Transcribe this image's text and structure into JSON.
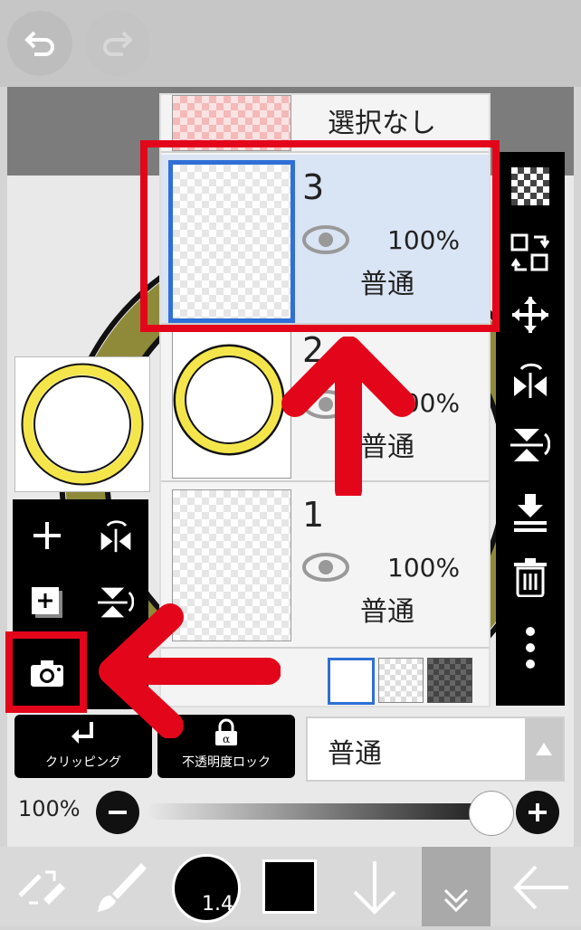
{
  "layers": [
    {
      "num": "3",
      "opacity": "100%",
      "mode": "普通",
      "selected": true
    },
    {
      "num": "2",
      "opacity": "100%",
      "mode": "普通",
      "selected": false
    },
    {
      "num": "1",
      "opacity": "100%",
      "mode": "普通",
      "selected": false
    }
  ],
  "selection_label": "選択なし",
  "clipping_label": "クリッピング",
  "opacity_lock_label": "不透明度ロック",
  "blend_mode_value": "普通",
  "opacity_slider": {
    "label": "100%",
    "value": 1.0
  },
  "brush_size_label": "1.4",
  "colors": {
    "accent_red": "#e3061b",
    "selected_row": "#d9e4f4",
    "selected_border": "#2f6fd6",
    "ring_yellow": "#f4e64a"
  },
  "icons": {
    "top": [
      "undo-icon",
      "redo-icon"
    ],
    "right_tools": [
      "transparency-icon",
      "move-layer-icon",
      "move-icon",
      "flip-horizontal-icon",
      "flip-vertical-icon",
      "merge-down-icon",
      "trash-icon",
      "more-icon"
    ],
    "left_tools": [
      "add-layer-icon",
      "flip-h-icon",
      "add-canvas-icon",
      "flip-v-icon",
      "camera-icon"
    ],
    "bottom": [
      "select-tool-icon",
      "brush-icon",
      "brush-size-icon",
      "color-swatch-icon",
      "arrow-down-icon",
      "expand-icon",
      "back-icon"
    ]
  }
}
